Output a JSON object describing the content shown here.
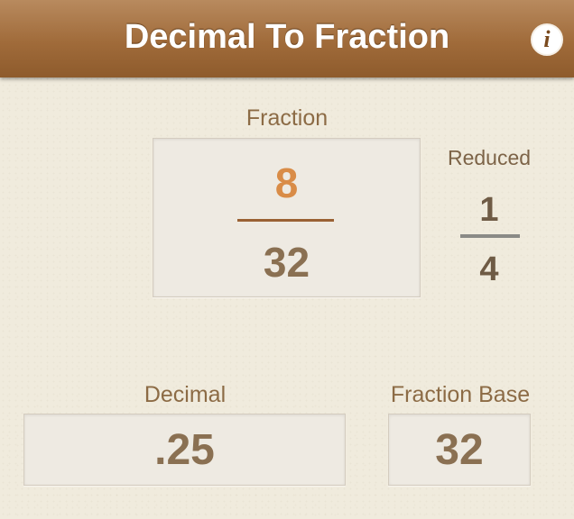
{
  "header": {
    "title": "Decimal To Fraction",
    "info_icon": "info-icon",
    "info_glyph": "i"
  },
  "fraction": {
    "label": "Fraction",
    "numerator": "8",
    "denominator": "32"
  },
  "reduced": {
    "label": "Reduced",
    "numerator": "1",
    "denominator": "4"
  },
  "decimal": {
    "label": "Decimal",
    "value": ".25"
  },
  "fraction_base": {
    "label": "Fraction Base",
    "value": "32"
  },
  "colors": {
    "header": "#a06b3a",
    "numerator": "#d98c47",
    "value_text": "#8a7052",
    "label_text": "#8c6b45"
  }
}
